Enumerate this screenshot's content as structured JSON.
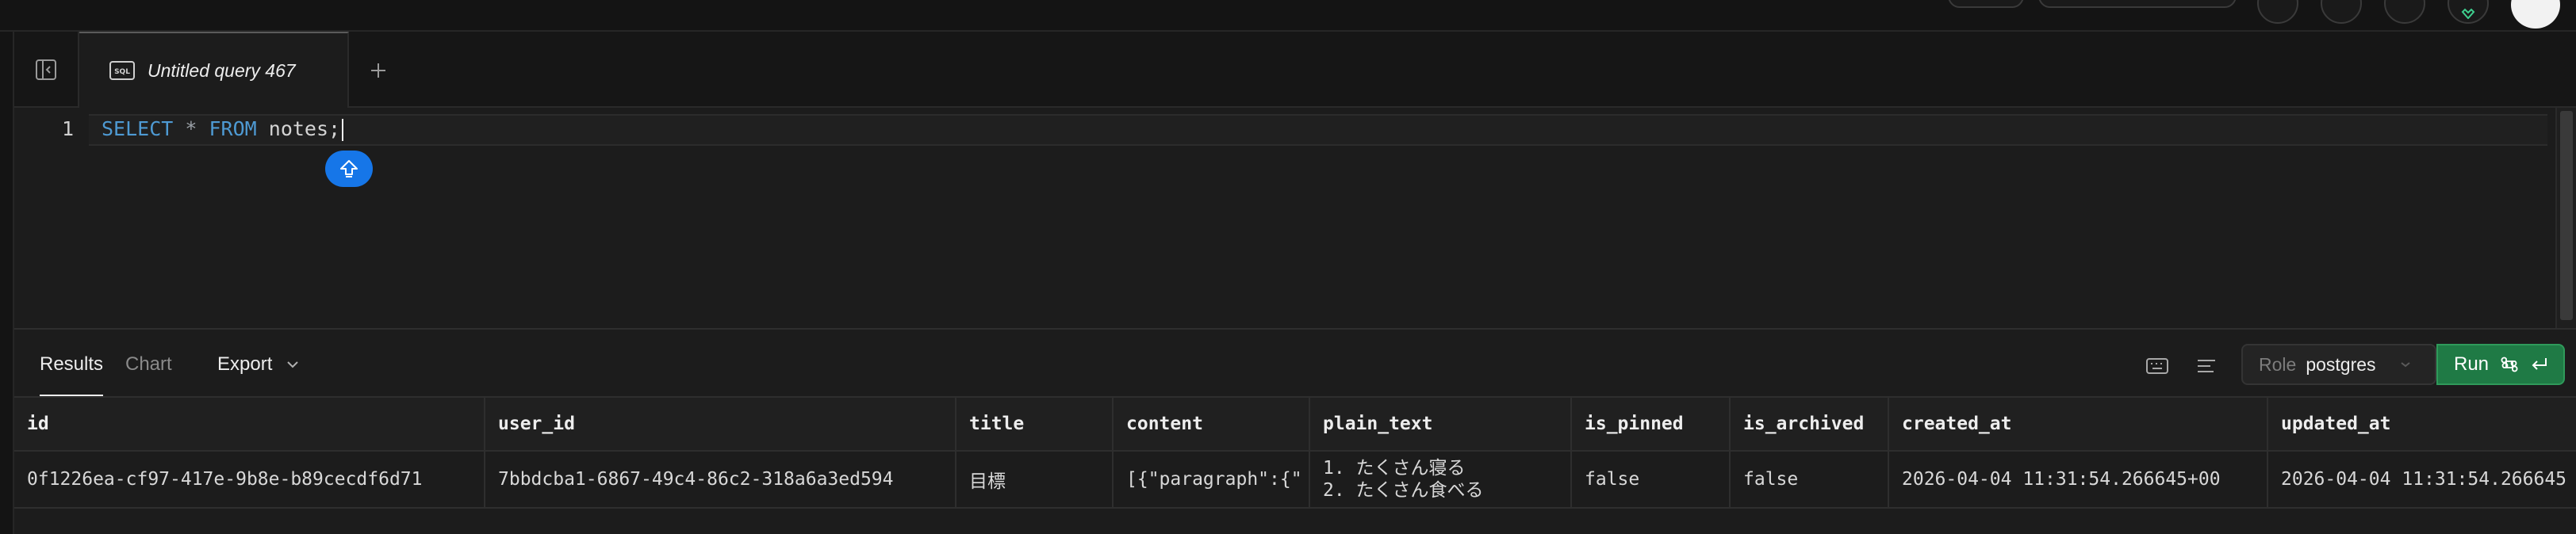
{
  "editor_tab": {
    "title": "Untitled query 467",
    "type_badge": "SQL"
  },
  "editor": {
    "line_number": "1",
    "tokens": {
      "select": "SELECT",
      "star": "*",
      "from": "FROM",
      "table": "notes;"
    }
  },
  "results": {
    "tabs": [
      {
        "label": "Results"
      },
      {
        "label": "Chart"
      }
    ],
    "export_label": "Export",
    "role_label": "Role",
    "role_value": "postgres",
    "run_label": "Run"
  },
  "grid": {
    "columns": [
      "id",
      "user_id",
      "title",
      "content",
      "plain_text",
      "is_pinned",
      "is_archived",
      "created_at",
      "updated_at"
    ],
    "rows": [
      {
        "id": "0f1226ea-cf97-417e-9b8e-b89cecdf6d71",
        "user_id": "7bbdcba1-6867-49c4-86c2-318a6a3ed594",
        "title": "目標",
        "content": "[{\"paragraph\":{\"",
        "plain_text_lines": [
          "1. たくさん寝る",
          "2. たくさん食べる"
        ],
        "is_pinned": "false",
        "is_archived": "false",
        "created_at": "2026-04-04 11:31:54.266645+00",
        "updated_at": "2026-04-04 11:31:54.266645"
      }
    ]
  },
  "colors": {
    "accent": "#1676e8",
    "run": "#1f7a45",
    "keyword": "#4e9ad3"
  }
}
